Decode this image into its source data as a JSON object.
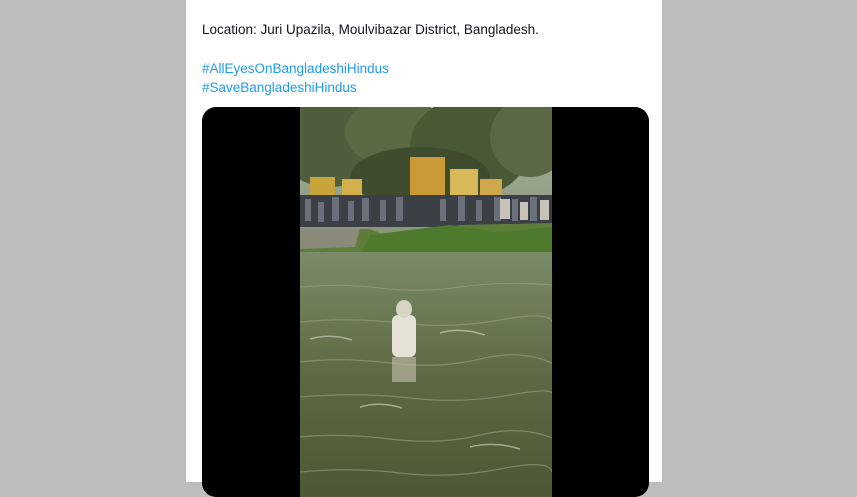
{
  "tweet": {
    "location_text": "Location: Juri Upazila, Moulvibazar District, Bangladesh.",
    "hashtags": [
      "#AllEyesOnBangladeshiHindus",
      "#SaveBangladeshiHindus"
    ]
  },
  "media": {
    "type": "video",
    "scene": "crowd-on-riverbank-person-in-water"
  },
  "colors": {
    "background": "#bdbdbd",
    "card": "#ffffff",
    "text": "#0f1419",
    "link": "#1d9bf0",
    "media_bg": "#000000"
  }
}
